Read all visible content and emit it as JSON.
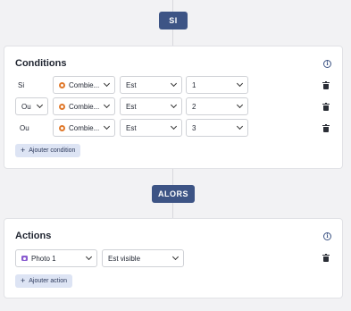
{
  "if_block": {
    "label": "SI"
  },
  "then_block": {
    "label": "ALORS"
  },
  "conditions": {
    "title": "Conditions",
    "rows": [
      {
        "connector": "Si",
        "field": "Combie...",
        "operator": "Est",
        "value": "1"
      },
      {
        "connector": "Ou",
        "field": "Combie...",
        "operator": "Est",
        "value": "2"
      },
      {
        "connector": "Ou",
        "field": "Combie...",
        "operator": "Est",
        "value": "3"
      }
    ],
    "add_label": "Ajouter condition"
  },
  "actions": {
    "title": "Actions",
    "rows": [
      {
        "target": "Photo 1",
        "action": "Est visible"
      }
    ],
    "add_label": "Ajouter action"
  },
  "colors": {
    "accent": "#3d5485",
    "add_button_bg": "#dde4f4",
    "field_icon": "#e0782a",
    "photo_icon": "#8a5cd0"
  },
  "icons": {
    "info": "info-circle-icon",
    "delete": "trash-icon",
    "field": "field-source-icon",
    "photo": "camera-icon",
    "dropdown": "chevron-down-icon",
    "add": "plus-icon"
  }
}
